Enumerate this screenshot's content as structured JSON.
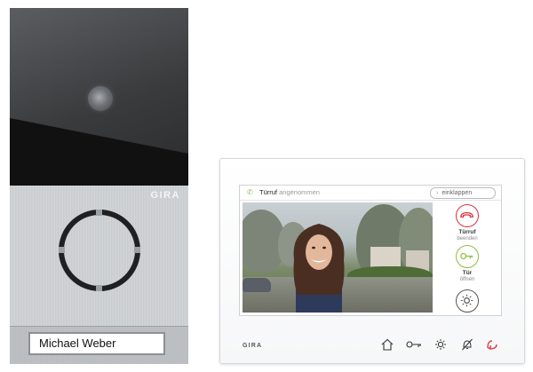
{
  "door_station": {
    "brand": "GIRA",
    "name_label": "Michael Weber"
  },
  "indoor_station": {
    "brand": "GIRA",
    "status": {
      "title_strong": "Türruf",
      "title_light": "angenommen"
    },
    "collapse_button": "einklappen",
    "actions": [
      {
        "label": "Türruf",
        "sublabel": "beenden",
        "icon": "hang-up-icon",
        "color": "#d9323a"
      },
      {
        "label": "Tür",
        "sublabel": "öffnen",
        "icon": "key-icon",
        "color": "#8fbf3f"
      },
      {
        "label": "",
        "sublabel": "",
        "icon": "light-icon",
        "color": "#555555"
      }
    ],
    "bottom_icons": [
      "home-icon",
      "key-icon",
      "light-icon",
      "mute-icon",
      "hang-up-icon"
    ]
  },
  "colors": {
    "accent_green": "#8fbf3f",
    "accent_red": "#d9323a"
  }
}
